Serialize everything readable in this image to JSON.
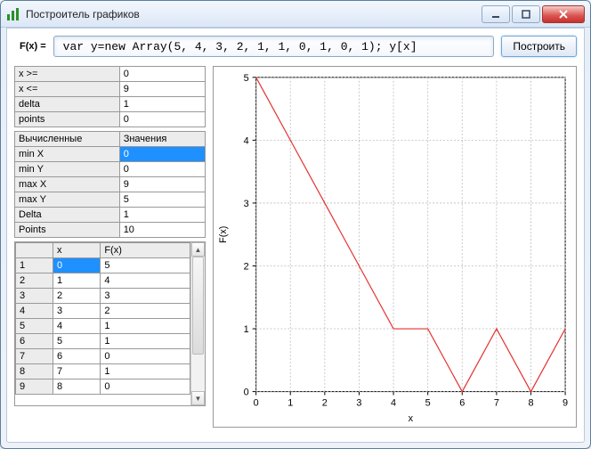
{
  "window": {
    "title": "Построитель графиков"
  },
  "formula": {
    "label": "F(x) =",
    "value": "var y=new Array(5, 4, 3, 2, 1, 1, 0, 1, 0, 1); y[x]",
    "build": "Построить"
  },
  "params": {
    "rows": [
      {
        "name": "x >=",
        "value": "0"
      },
      {
        "name": "x <=",
        "value": "9"
      },
      {
        "name": "delta",
        "value": "1"
      },
      {
        "name": "points",
        "value": "0"
      }
    ]
  },
  "computed": {
    "header_left": "Вычисленные",
    "header_right": "Значения",
    "rows": [
      {
        "name": "min X",
        "value": "0",
        "selected": true
      },
      {
        "name": "min Y",
        "value": "0"
      },
      {
        "name": "max X",
        "value": "9"
      },
      {
        "name": "max Y",
        "value": "5"
      },
      {
        "name": "Delta",
        "value": "1"
      },
      {
        "name": "Points",
        "value": "10"
      }
    ]
  },
  "data_table": {
    "col_x": "x",
    "col_fx": "F(x)",
    "rows": [
      {
        "i": "1",
        "x": "0",
        "fx": "5",
        "selected": true
      },
      {
        "i": "2",
        "x": "1",
        "fx": "4"
      },
      {
        "i": "3",
        "x": "2",
        "fx": "3"
      },
      {
        "i": "4",
        "x": "3",
        "fx": "2"
      },
      {
        "i": "5",
        "x": "4",
        "fx": "1"
      },
      {
        "i": "6",
        "x": "5",
        "fx": "1"
      },
      {
        "i": "7",
        "x": "6",
        "fx": "0"
      },
      {
        "i": "8",
        "x": "7",
        "fx": "1"
      },
      {
        "i": "9",
        "x": "8",
        "fx": "0"
      }
    ]
  },
  "chart_data": {
    "type": "line",
    "xlabel": "x",
    "ylabel": "F(x)",
    "xlim": [
      0,
      9
    ],
    "ylim": [
      0,
      5
    ],
    "xticks": [
      0,
      1,
      2,
      3,
      4,
      5,
      6,
      7,
      8,
      9
    ],
    "yticks": [
      0,
      1,
      2,
      3,
      4,
      5
    ],
    "series": [
      {
        "name": "F(x)",
        "x": [
          0,
          1,
          2,
          3,
          4,
          5,
          6,
          7,
          8,
          9
        ],
        "y": [
          5,
          4,
          3,
          2,
          1,
          1,
          0,
          1,
          0,
          1
        ],
        "color": "#e63030"
      }
    ]
  }
}
